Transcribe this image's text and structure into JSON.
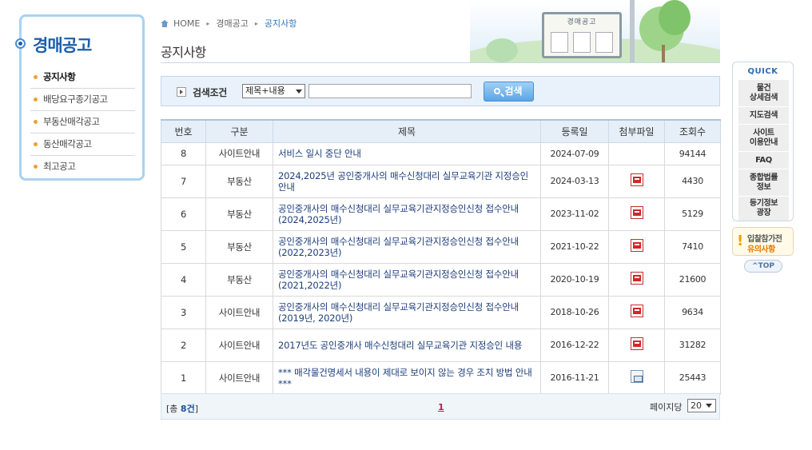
{
  "sidebar": {
    "title": "경매공고",
    "items": [
      {
        "label": "공지사항",
        "active": true
      },
      {
        "label": "배당요구종기공고",
        "active": false
      },
      {
        "label": "부동산매각공고",
        "active": false
      },
      {
        "label": "동산매각공고",
        "active": false
      },
      {
        "label": "최고공고",
        "active": false
      }
    ]
  },
  "breadcrumb": {
    "home": "HOME",
    "section": "경매공고",
    "current": "공지사항"
  },
  "page_title": "공지사항",
  "header_art": {
    "board_title": "경매공고"
  },
  "search": {
    "label": "검색조건",
    "select_value": "제목+내용",
    "input_value": "",
    "button_label": "검색"
  },
  "table": {
    "headers": [
      "번호",
      "구분",
      "제목",
      "등록일",
      "첨부파일",
      "조회수"
    ],
    "rows": [
      {
        "no": "8",
        "category": "사이트안내",
        "title": "서비스 일시 중단 안내",
        "date": "2024-07-09",
        "attachment": "",
        "views": "94144"
      },
      {
        "no": "7",
        "category": "부동산",
        "title": "2024,2025년 공인중개사의 매수신청대리 실무교육기관 지정승인 안내",
        "date": "2024-03-13",
        "attachment": "pdf",
        "views": "4430"
      },
      {
        "no": "6",
        "category": "부동산",
        "title": "공인중개사의 매수신청대리 실무교육기관지정승인신청 접수안내(2024,2025년)",
        "date": "2023-11-02",
        "attachment": "pdf",
        "views": "5129"
      },
      {
        "no": "5",
        "category": "부동산",
        "title": "공인중개사의 매수신청대리 실무교육기관지정승인신청 접수안내(2022,2023년)",
        "date": "2021-10-22",
        "attachment": "pdf",
        "views": "7410"
      },
      {
        "no": "4",
        "category": "부동산",
        "title": "공인중개사의 매수신청대리 실무교육기관지정승인신청 접수안내(2021,2022년)",
        "date": "2020-10-19",
        "attachment": "pdf",
        "views": "21600"
      },
      {
        "no": "3",
        "category": "사이트안내",
        "title": "공인중개사의 매수신청대리 실무교육기관지정승인신청 접수안내(2019년, 2020년)",
        "date": "2018-10-26",
        "attachment": "pdf",
        "views": "9634"
      },
      {
        "no": "2",
        "category": "사이트안내",
        "title": "2017년도 공인중개사 매수신청대리 실무교육기관 지정승인 내용",
        "date": "2016-12-22",
        "attachment": "pdf",
        "views": "31282"
      },
      {
        "no": "1",
        "category": "사이트안내",
        "title": "*** 매각물건명세서 내용이 제대로 보이지 않는 경우 조치 방법 안내 ***",
        "date": "2016-11-21",
        "attachment": "doc",
        "views": "25443"
      }
    ]
  },
  "footer": {
    "total_prefix": "[총 ",
    "total_count": "8건",
    "total_suffix": "]",
    "current_page": "1",
    "per_page_label": "페이지당",
    "per_page_value": "20"
  },
  "quick": {
    "title": "QUICK",
    "items": [
      "물건\n상세검색",
      "지도검색",
      "사이트\n이용안내",
      "FAQ",
      "종합법률\n정보",
      "등기정보\n광장"
    ],
    "notice_line1": "입찰참가전",
    "notice_line2": "유의사항",
    "top_label": "^TOP"
  }
}
